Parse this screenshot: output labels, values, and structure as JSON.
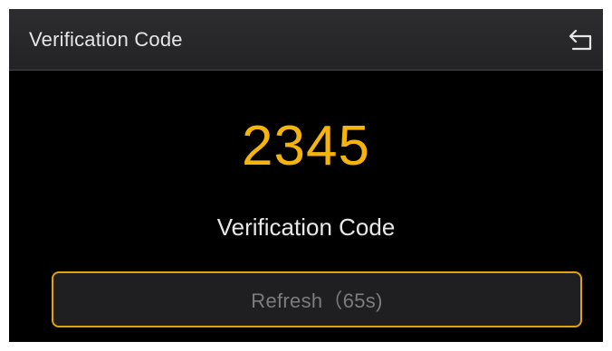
{
  "header": {
    "title": "Verification Code",
    "back_icon": "back-arrow-icon"
  },
  "main": {
    "code": "2345",
    "code_label": "Verification Code",
    "refresh_label": "Refresh（65s)"
  },
  "colors": {
    "accent": "#f5b30d",
    "background": "#000000",
    "header": "#2a2a2c",
    "button_border": "#e2a10f",
    "button_text": "#7c7c7e"
  }
}
